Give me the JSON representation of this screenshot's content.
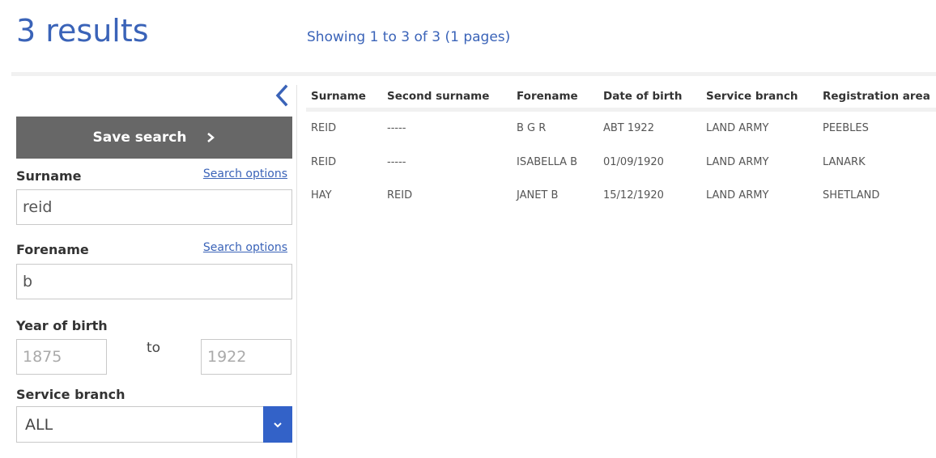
{
  "header": {
    "results_title": "3 results",
    "showing_text": "Showing 1 to 3 of 3 (1 pages)"
  },
  "sidebar": {
    "collapse_icon": "chevron-left-icon",
    "save_search_label": "Save search",
    "save_search_icon": "chevron-right-icon",
    "surname": {
      "label": "Surname",
      "search_options_label": "Search options",
      "value": "reid"
    },
    "forename": {
      "label": "Forename",
      "search_options_label": "Search options",
      "value": "b"
    },
    "year_of_birth": {
      "label": "Year of birth",
      "from_placeholder": "1875",
      "to_label": "to",
      "to_placeholder": "1922"
    },
    "service_branch": {
      "label": "Service branch",
      "selected": "ALL",
      "arrow_icon": "chevron-down-icon"
    }
  },
  "table": {
    "columns": [
      "Surname",
      "Second surname",
      "Forename",
      "Date of birth",
      "Service branch",
      "Registration area"
    ],
    "rows": [
      [
        "REID",
        "-----",
        "B G R",
        "ABT 1922",
        "LAND ARMY",
        "PEEBLES"
      ],
      [
        "REID",
        "-----",
        "ISABELLA B",
        "01/09/1920",
        "LAND ARMY",
        "LANARK"
      ],
      [
        "HAY",
        "REID",
        "JANET B",
        "15/12/1920",
        "LAND ARMY",
        "SHETLAND"
      ]
    ]
  },
  "colors": {
    "accent": "#3a63b8",
    "button_gray": "#676767",
    "select_arrow_bg": "#3362c8"
  }
}
